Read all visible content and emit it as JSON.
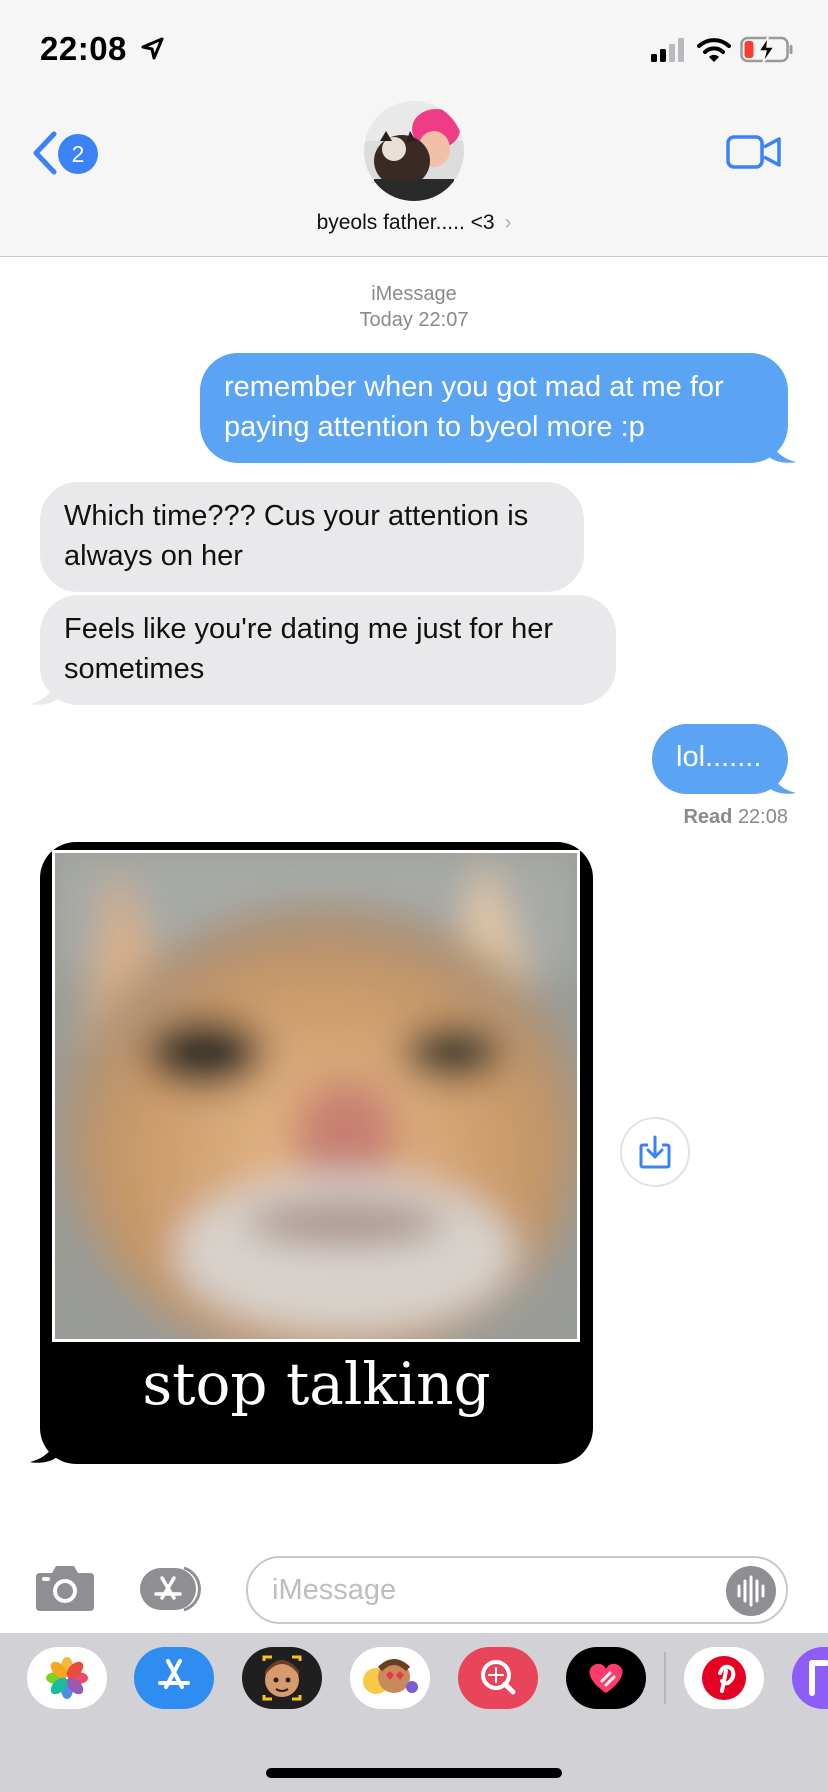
{
  "status_bar": {
    "time": "22:08"
  },
  "header": {
    "back_badge_count": "2",
    "contact_name": "byeols father..... <3",
    "chevron": "›"
  },
  "thread": {
    "service_label": "iMessage",
    "timestamp": "Today 22:07",
    "messages": [
      {
        "side": "sent",
        "text": "remember when you got mad at me for paying attention to byeol more :p"
      },
      {
        "side": "received",
        "text": "Which time??? Cus your attention is always on her"
      },
      {
        "side": "received",
        "text": "Feels like you're dating me just for her sometimes"
      },
      {
        "side": "sent",
        "text": "lol......."
      }
    ],
    "read_receipt": {
      "label": "Read",
      "time": "22:08"
    },
    "meme": {
      "caption": "stop talking"
    }
  },
  "input_bar": {
    "placeholder": "iMessage"
  },
  "icons": {
    "status": [
      "location-arrow-icon",
      "cellular-signal-icon",
      "wifi-icon",
      "battery-charging-icon"
    ],
    "header": [
      "back-chevron-icon",
      "facetime-video-icon"
    ],
    "input": [
      "camera-icon",
      "app-store-icon",
      "audio-waveform-icon"
    ],
    "drawer": [
      "photos-app-icon",
      "app-store-app-icon",
      "memoji-app-icon",
      "animoji-app-icon",
      "search-images-app-icon",
      "digital-touch-app-icon",
      "pinterest-app-icon",
      "partial-app-icon"
    ],
    "save": "save-download-icon"
  },
  "colors": {
    "sent_bubble": "#5ba4f4",
    "received_bubble": "#e9e9eb",
    "accent": "#3b82f6",
    "battery_low": "#ff3b30"
  }
}
